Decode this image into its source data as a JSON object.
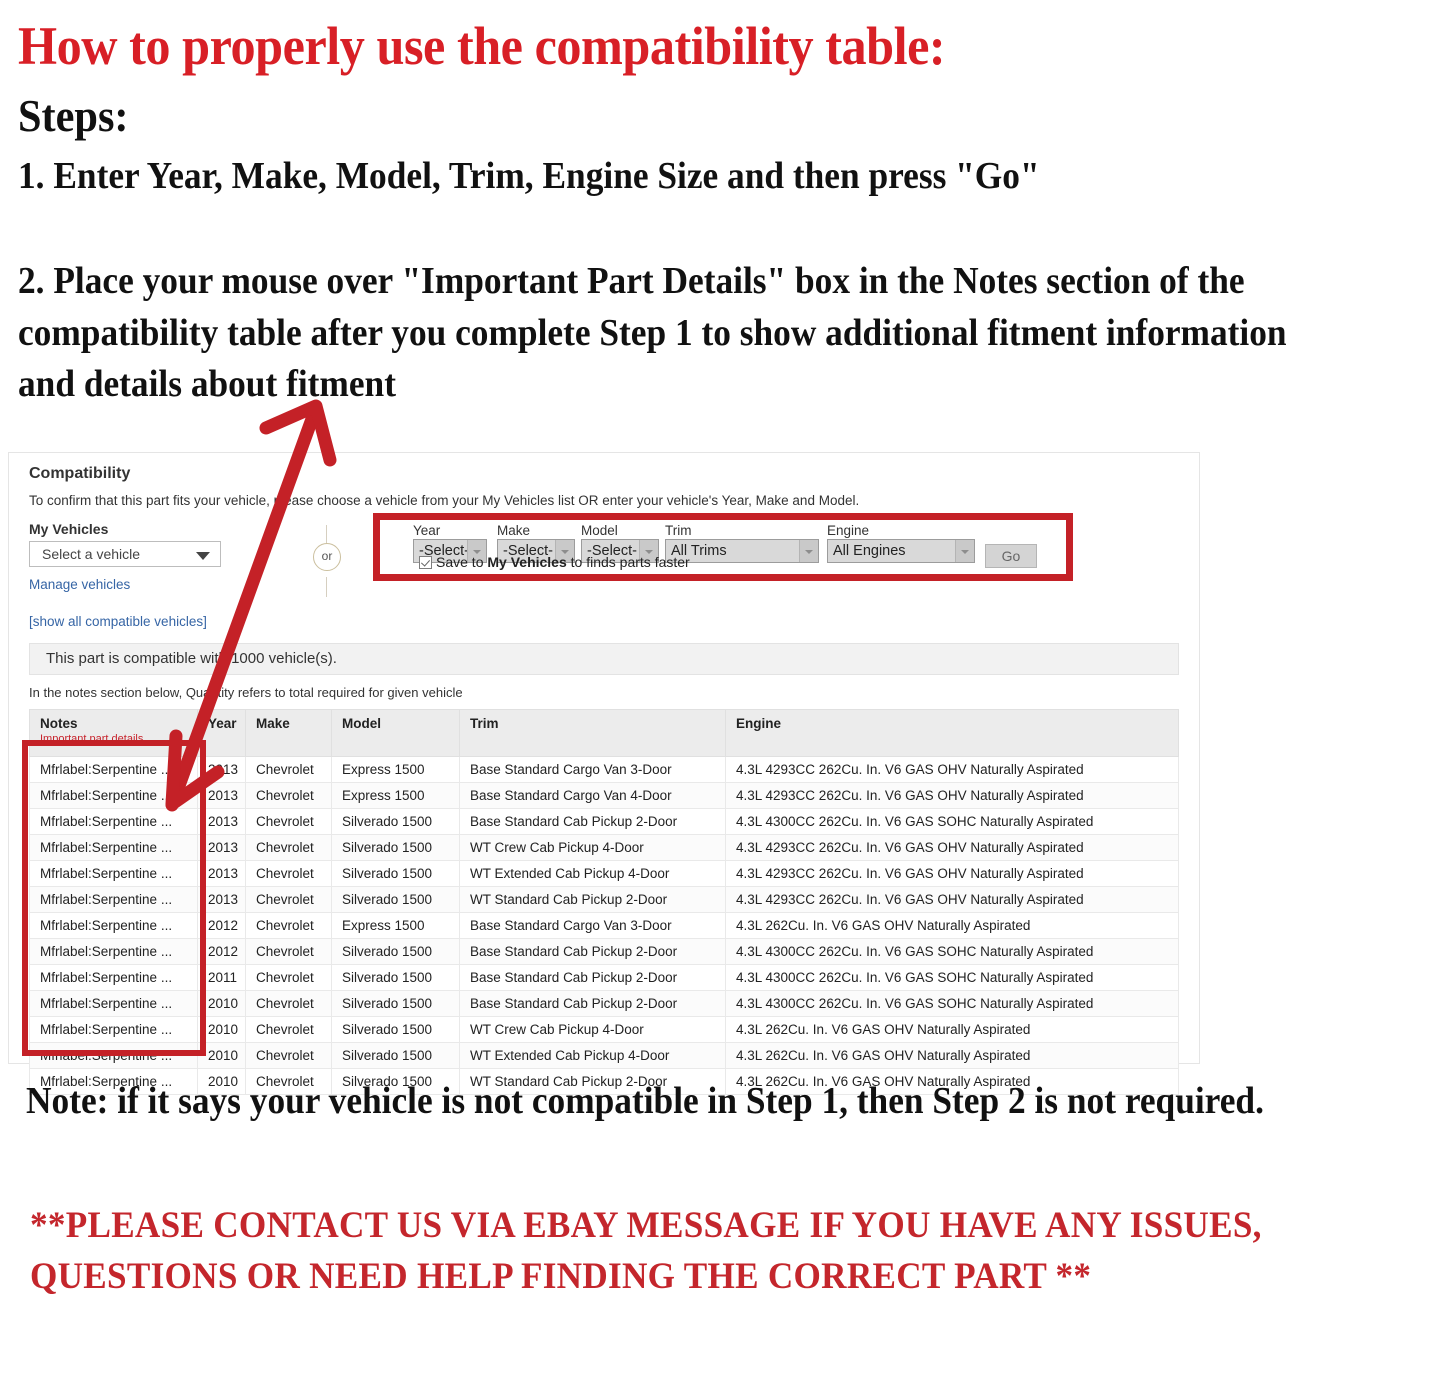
{
  "instructions": {
    "title": "How to properly use the compatibility table:",
    "steps_heading": "Steps:",
    "step1": "1. Enter Year, Make, Model, Trim, Engine Size and then press \"Go\"",
    "step2": "2. Place your mouse over \"Important Part Details\" box in the Notes section of the compatibility table after you complete Step 1 to show additional fitment information and details about fitment",
    "note": "Note: if it says your vehicle is not compatible in Step 1, then Step 2 is not required.",
    "contact": "**PLEASE CONTACT US VIA EBAY MESSAGE IF YOU HAVE ANY ISSUES, QUESTIONS OR NEED HELP FINDING THE CORRECT PART **"
  },
  "compatibility": {
    "title": "Compatibility",
    "subtitle": "To confirm that this part fits your vehicle, please choose a vehicle from your My Vehicles list OR enter your vehicle's Year, Make and Model.",
    "my_vehicles_label": "My Vehicles",
    "vehicle_select_value": "Select a vehicle",
    "manage_vehicles_link": "Manage vehicles",
    "show_all_link": "[show all compatible vehicles]",
    "or_divider": "or",
    "count_text": "This part is compatible with 1000 vehicle(s).",
    "quantity_note": "In the notes section below, Quantity refers to total required for given vehicle",
    "form": {
      "year": {
        "label": "Year",
        "value": "-Select-"
      },
      "make": {
        "label": "Make",
        "value": "-Select-"
      },
      "model": {
        "label": "Model",
        "value": "-Select-"
      },
      "trim": {
        "label": "Trim",
        "value": "All Trims"
      },
      "engine": {
        "label": "Engine",
        "value": "All Engines"
      },
      "go_label": "Go",
      "save_prefix": "Save to ",
      "save_bold": "My Vehicles",
      "save_suffix": " to finds parts faster"
    },
    "table": {
      "headers": {
        "notes": "Notes",
        "notes_sub": "Important part details",
        "year": "Year",
        "make": "Make",
        "model": "Model",
        "trim": "Trim",
        "engine": "Engine"
      },
      "rows": [
        {
          "notes": "Mfrlabel:Serpentine ...",
          "year": "2013",
          "make": "Chevrolet",
          "model": "Express 1500",
          "trim": "Base Standard Cargo Van 3-Door",
          "engine": "4.3L 4293CC 262Cu. In. V6 GAS OHV Naturally Aspirated"
        },
        {
          "notes": "Mfrlabel:Serpentine ...",
          "year": "2013",
          "make": "Chevrolet",
          "model": "Express 1500",
          "trim": "Base Standard Cargo Van 4-Door",
          "engine": "4.3L 4293CC 262Cu. In. V6 GAS OHV Naturally Aspirated"
        },
        {
          "notes": "Mfrlabel:Serpentine ...",
          "year": "2013",
          "make": "Chevrolet",
          "model": "Silverado 1500",
          "trim": "Base Standard Cab Pickup 2-Door",
          "engine": "4.3L 4300CC 262Cu. In. V6 GAS SOHC Naturally Aspirated"
        },
        {
          "notes": "Mfrlabel:Serpentine ...",
          "year": "2013",
          "make": "Chevrolet",
          "model": "Silverado 1500",
          "trim": "WT Crew Cab Pickup 4-Door",
          "engine": "4.3L 4293CC 262Cu. In. V6 GAS OHV Naturally Aspirated"
        },
        {
          "notes": "Mfrlabel:Serpentine ...",
          "year": "2013",
          "make": "Chevrolet",
          "model": "Silverado 1500",
          "trim": "WT Extended Cab Pickup 4-Door",
          "engine": "4.3L 4293CC 262Cu. In. V6 GAS OHV Naturally Aspirated"
        },
        {
          "notes": "Mfrlabel:Serpentine ...",
          "year": "2013",
          "make": "Chevrolet",
          "model": "Silverado 1500",
          "trim": "WT Standard Cab Pickup 2-Door",
          "engine": "4.3L 4293CC 262Cu. In. V6 GAS OHV Naturally Aspirated"
        },
        {
          "notes": "Mfrlabel:Serpentine ...",
          "year": "2012",
          "make": "Chevrolet",
          "model": "Express 1500",
          "trim": "Base Standard Cargo Van 3-Door",
          "engine": "4.3L 262Cu. In. V6 GAS OHV Naturally Aspirated"
        },
        {
          "notes": "Mfrlabel:Serpentine ...",
          "year": "2012",
          "make": "Chevrolet",
          "model": "Silverado 1500",
          "trim": "Base Standard Cab Pickup 2-Door",
          "engine": "4.3L 4300CC 262Cu. In. V6 GAS SOHC Naturally Aspirated"
        },
        {
          "notes": "Mfrlabel:Serpentine ...",
          "year": "2011",
          "make": "Chevrolet",
          "model": "Silverado 1500",
          "trim": "Base Standard Cab Pickup 2-Door",
          "engine": "4.3L 4300CC 262Cu. In. V6 GAS SOHC Naturally Aspirated"
        },
        {
          "notes": "Mfrlabel:Serpentine ...",
          "year": "2010",
          "make": "Chevrolet",
          "model": "Silverado 1500",
          "trim": "Base Standard Cab Pickup 2-Door",
          "engine": "4.3L 4300CC 262Cu. In. V6 GAS SOHC Naturally Aspirated"
        },
        {
          "notes": "Mfrlabel:Serpentine ...",
          "year": "2010",
          "make": "Chevrolet",
          "model": "Silverado 1500",
          "trim": "WT Crew Cab Pickup 4-Door",
          "engine": "4.3L 262Cu. In. V6 GAS OHV Naturally Aspirated"
        },
        {
          "notes": "Mfrlabel:Serpentine ...",
          "year": "2010",
          "make": "Chevrolet",
          "model": "Silverado 1500",
          "trim": "WT Extended Cab Pickup 4-Door",
          "engine": "4.3L 262Cu. In. V6 GAS OHV Naturally Aspirated"
        },
        {
          "notes": "Mfrlabel:Serpentine ...",
          "year": "2010",
          "make": "Chevrolet",
          "model": "Silverado 1500",
          "trim": "WT Standard Cab Pickup 2-Door",
          "engine": "4.3L 262Cu. In. V6 GAS OHV Naturally Aspirated"
        }
      ]
    }
  },
  "colors": {
    "brand_red": "#d81f26",
    "annotation_red": "#c42127",
    "link_blue": "#3665a5",
    "note_sub_red": "#c7232c"
  }
}
